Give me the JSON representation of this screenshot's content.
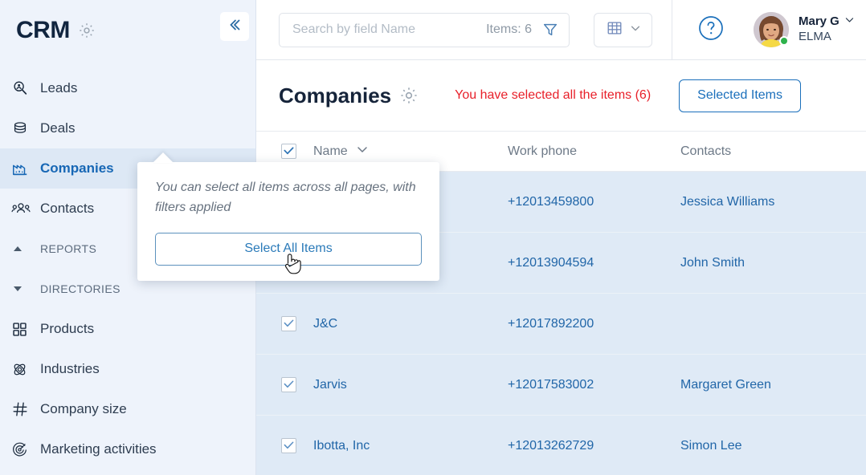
{
  "sidebar": {
    "brand": "CRM",
    "brand_gear_icon": "gear-icon",
    "collapse_icon": "chevron-double-left-icon",
    "items": [
      {
        "label": "Leads",
        "icon": "lead-search-icon",
        "active": false
      },
      {
        "label": "Deals",
        "icon": "coins-stack-icon",
        "active": false
      },
      {
        "label": "Companies",
        "icon": "factory-icon",
        "active": true
      },
      {
        "label": "Contacts",
        "icon": "people-icon",
        "active": false
      }
    ],
    "sections": [
      {
        "label": "REPORTS",
        "icon": "caret-up-icon",
        "expanded": false
      },
      {
        "label": "DIRECTORIES",
        "icon": "caret-down-icon",
        "expanded": true
      }
    ],
    "directory_items": [
      {
        "label": "Products",
        "icon": "grid-squares-icon"
      },
      {
        "label": "Industries",
        "icon": "atom-icon"
      },
      {
        "label": "Company size",
        "icon": "hash-icon"
      },
      {
        "label": "Marketing activities",
        "icon": "target-icon"
      }
    ]
  },
  "topbar": {
    "search": {
      "placeholder": "Search by field Name",
      "value": "",
      "items_count_label": "Items: 6",
      "filter_icon": "funnel-icon"
    },
    "view_button": {
      "icon": "table-view-icon",
      "chevron": "chevron-down-icon"
    },
    "help_icon": "question-circle-icon",
    "user": {
      "name": "Mary G",
      "org": "ELMA",
      "chevron": "chevron-down-icon",
      "status": "online",
      "status_color": "#2eb24c"
    }
  },
  "page": {
    "title": "Companies",
    "title_gear_icon": "gear-icon",
    "selection_note": "You have selected all the items (6)",
    "selection_note_color": "#e8202a",
    "selected_items_button": "Selected Items"
  },
  "popup": {
    "message": "You can select all items across all pages, with filters applied",
    "button": "Select All Items",
    "cursor_icon": "pointing-hand-cursor"
  },
  "table": {
    "header_checkbox_checked": true,
    "columns": [
      {
        "key": "name",
        "label": "Name",
        "sort_icon": "chevron-down-icon"
      },
      {
        "key": "phone",
        "label": "Work phone",
        "sort_icon": ""
      },
      {
        "key": "contacts",
        "label": "Contacts",
        "sort_icon": ""
      }
    ],
    "rows": [
      {
        "checked": true,
        "name": "",
        "phone": "+12013459800",
        "contacts": "Jessica Williams"
      },
      {
        "checked": true,
        "name": "",
        "phone": "+12013904594",
        "contacts": "John Smith"
      },
      {
        "checked": true,
        "name": "J&C",
        "phone": "+12017892200",
        "contacts": ""
      },
      {
        "checked": true,
        "name": "Jarvis",
        "phone": "+12017583002",
        "contacts": "Margaret Green"
      },
      {
        "checked": true,
        "name": "Ibotta, Inc",
        "phone": "+12013262729",
        "contacts": "Simon Lee"
      }
    ],
    "row_selected_bg": "#dfeaf6"
  }
}
